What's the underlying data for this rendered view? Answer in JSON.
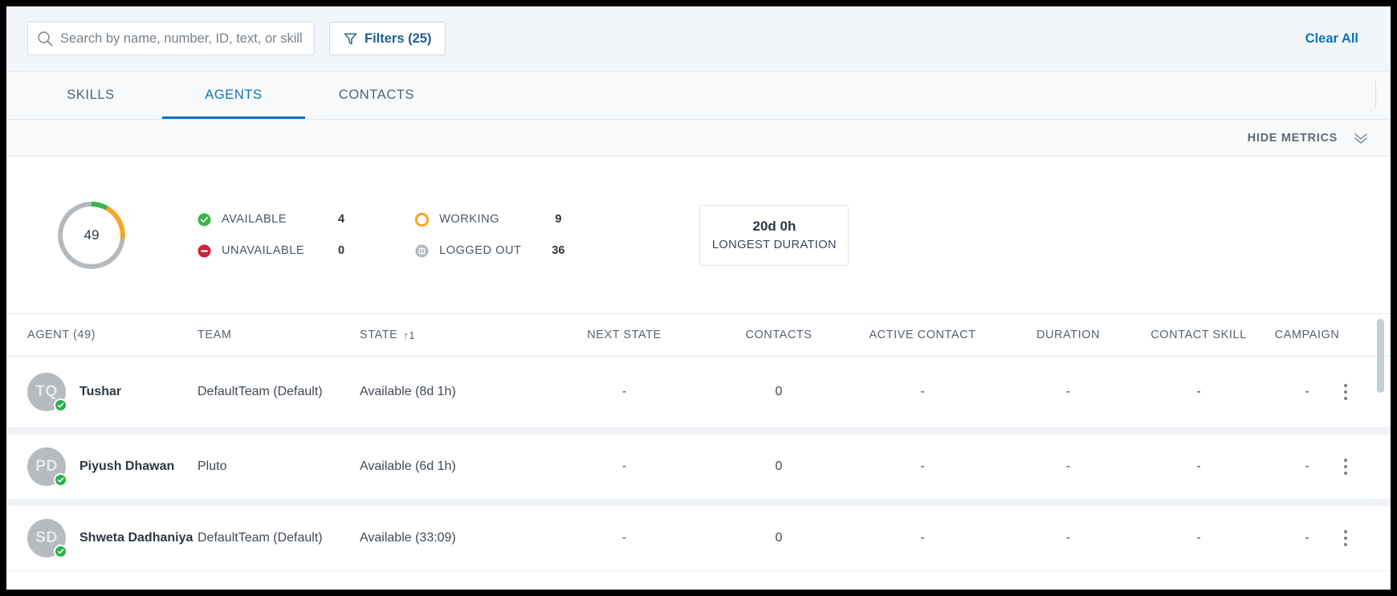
{
  "search": {
    "placeholder": "Search by name, number, ID, text, or skill",
    "value": "",
    "icon": "search-icon"
  },
  "filters": {
    "label": "Filters (25)",
    "icon": "funnel-icon"
  },
  "clear_all": {
    "label": "Clear All"
  },
  "tabs": [
    {
      "label": "SKILLS",
      "active": false
    },
    {
      "label": "AGENTS",
      "active": true
    },
    {
      "label": "CONTACTS",
      "active": false
    }
  ],
  "metrics_toggle": {
    "label": "HIDE METRICS",
    "icon": "chevron-double-down-icon"
  },
  "chart_data": {
    "type": "pie",
    "title": "",
    "center_label": "49",
    "total": 49,
    "categories": [
      "AVAILABLE",
      "WORKING",
      "UNAVAILABLE",
      "LOGGED OUT"
    ],
    "values": [
      4,
      9,
      0,
      36
    ],
    "colors": [
      "#39b54a",
      "#f5a623",
      "#c9253e",
      "#b4b9be"
    ],
    "legend_position": "right"
  },
  "metrics": {
    "donut_center": "49",
    "items": [
      {
        "label": "AVAILABLE",
        "value": "4",
        "icon": "check-circle-icon",
        "color": "#39b54a"
      },
      {
        "label": "WORKING",
        "value": "9",
        "icon": "circle-ring-icon",
        "color": "#f5a623"
      },
      {
        "label": "UNAVAILABLE",
        "value": "0",
        "icon": "minus-circle-icon",
        "color": "#c9253e"
      },
      {
        "label": "LOGGED OUT",
        "value": "36",
        "icon": "logout-circle-icon",
        "color": "#b4b9be"
      }
    ],
    "duration_card": {
      "value": "20d 0h",
      "label": "LONGEST DURATION"
    }
  },
  "table": {
    "columns": [
      {
        "label": "AGENT (49)",
        "sort": ""
      },
      {
        "label": "TEAM",
        "sort": ""
      },
      {
        "label": "STATE",
        "sort": "↑1"
      },
      {
        "label": "NEXT STATE",
        "sort": ""
      },
      {
        "label": "CONTACTS",
        "sort": ""
      },
      {
        "label": "ACTIVE CONTACT",
        "sort": ""
      },
      {
        "label": "DURATION",
        "sort": ""
      },
      {
        "label": "CONTACT SKILL",
        "sort": ""
      },
      {
        "label": "CAMPAIGN",
        "sort": ""
      }
    ],
    "rows": [
      {
        "initials": "TQ",
        "name": "Tushar",
        "team": "DefaultTeam (Default)",
        "state": "Available (8d 1h)",
        "next_state": "-",
        "contacts": "0",
        "active_contact": "-",
        "duration": "-",
        "contact_skill": "-",
        "campaign": "-",
        "presence": "available"
      },
      {
        "initials": "PD",
        "name": "Piyush Dhawan",
        "team": "Pluto",
        "state": "Available (6d 1h)",
        "next_state": "-",
        "contacts": "0",
        "active_contact": "-",
        "duration": "-",
        "contact_skill": "-",
        "campaign": "-",
        "presence": "available"
      },
      {
        "initials": "SD",
        "name": "Shweta Dadhaniya",
        "team": "DefaultTeam (Default)",
        "state": "Available (33:09)",
        "next_state": "-",
        "contacts": "0",
        "active_contact": "-",
        "duration": "-",
        "contact_skill": "-",
        "campaign": "-",
        "presence": "available"
      }
    ]
  }
}
